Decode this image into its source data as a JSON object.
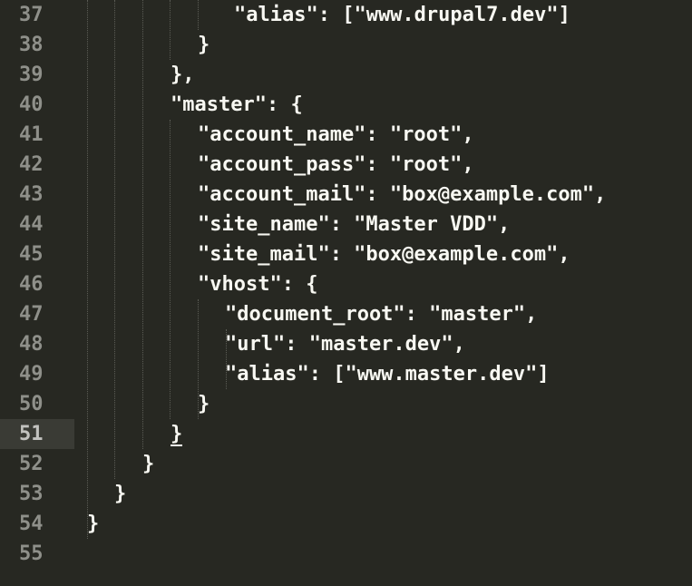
{
  "editor": {
    "theme_colors": {
      "background": "#272822",
      "text": "#f8f8f2",
      "line_number": "#8f908a",
      "active_line_number_bg": "#3a3b35",
      "indent_guide": "#5b5c55"
    },
    "active_line": "51",
    "lines": [
      {
        "num": "37",
        "text": "\"alias\": [\"www.drupal7.dev\"]"
      },
      {
        "num": "38",
        "text": "}"
      },
      {
        "num": "39",
        "text": "},"
      },
      {
        "num": "40",
        "text": "\"master\": {"
      },
      {
        "num": "41",
        "text": "\"account_name\": \"root\","
      },
      {
        "num": "42",
        "text": "\"account_pass\": \"root\","
      },
      {
        "num": "43",
        "text": "\"account_mail\": \"box@example.com\","
      },
      {
        "num": "44",
        "text": "\"site_name\": \"Master VDD\","
      },
      {
        "num": "45",
        "text": "\"site_mail\": \"box@example.com\","
      },
      {
        "num": "46",
        "text": "\"vhost\": {"
      },
      {
        "num": "47",
        "text": "\"document_root\": \"master\","
      },
      {
        "num": "48",
        "text": "\"url\": \"master.dev\","
      },
      {
        "num": "49",
        "text": "\"alias\": [\"www.master.dev\"]"
      },
      {
        "num": "50",
        "text": "}"
      },
      {
        "num": "51",
        "text": "}"
      },
      {
        "num": "52",
        "text": "}"
      },
      {
        "num": "53",
        "text": "}"
      },
      {
        "num": "54",
        "text": "}"
      },
      {
        "num": "55",
        "text": ""
      }
    ]
  }
}
